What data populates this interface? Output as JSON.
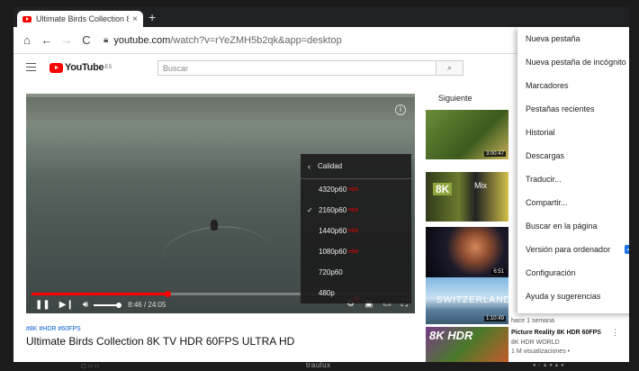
{
  "browser": {
    "tab_title": "Ultimate Birds Collection 8K",
    "tab_close": "×",
    "new_tab": "+",
    "back": "←",
    "forward": "→",
    "reload": "C",
    "home": "⌂",
    "url_host": "youtube.com",
    "url_path": "/watch?v=rYeZMH5b2qk&app=desktop"
  },
  "youtube": {
    "logo_text": "YouTube",
    "logo_region": "ES",
    "search_placeholder": "Buscar",
    "search_icon": "⌕"
  },
  "player": {
    "info_icon": "i",
    "time": "8:46 / 24:05",
    "progress_fraction": 0.36,
    "volume_fraction": 0.8,
    "hd_badge": "HD"
  },
  "quality_menu": {
    "header": "Calidad",
    "items": [
      {
        "label": "4320p60",
        "hdr": true,
        "selected": false
      },
      {
        "label": "2160p60",
        "hdr": true,
        "selected": true
      },
      {
        "label": "1440p60",
        "hdr": true,
        "selected": false
      },
      {
        "label": "1080p60",
        "hdr": true,
        "selected": false
      },
      {
        "label": "720p60",
        "hdr": false,
        "selected": false
      },
      {
        "label": "480p",
        "hdr": false,
        "selected": false
      }
    ],
    "hdr_label": "HDR",
    "check_glyph": "✓"
  },
  "video": {
    "tags": "#8K #HDR #60FPS",
    "title": "Ultimate Birds Collection 8K TV HDR 60FPS ULTRA HD"
  },
  "sidebar": {
    "heading": "Siguiente",
    "thumbs": [
      {
        "duration": "3:00:47"
      },
      {
        "duration": "",
        "badge": "8K",
        "text": "Mix"
      },
      {
        "duration": "6:51"
      },
      {
        "duration": "1:10:49",
        "text": "SWITZERLAND"
      },
      {
        "duration": "",
        "badge": "8K HDR"
      }
    ],
    "meta_above": "hace 1 semana",
    "last_title": "Picture Reality 8K HDR 60FPS",
    "last_channel": "8K HDR WORLD",
    "last_views": "1 M visualizaciones •",
    "more": "⋮"
  },
  "chrome_menu": {
    "items": [
      {
        "label": "Nueva pestaña"
      },
      {
        "label": "Nueva pestaña de incógnito"
      },
      {
        "label": "Marcadores"
      },
      {
        "label": "Pestañas recientes"
      },
      {
        "label": "Historial"
      },
      {
        "label": "Descargas"
      },
      {
        "label": "Traducir..."
      },
      {
        "label": "Compartir..."
      },
      {
        "label": "Buscar en la página"
      },
      {
        "label": "Versión para ordenador",
        "checked": true
      },
      {
        "label": "Configuración"
      },
      {
        "label": "Ayuda y sugerencias"
      }
    ]
  },
  "bezel": {
    "brand": "traulux"
  }
}
